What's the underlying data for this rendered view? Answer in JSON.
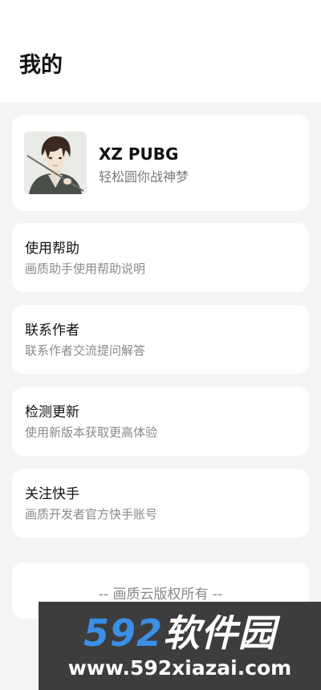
{
  "page": {
    "title": "我的"
  },
  "profile": {
    "avatar_icon": "avatar-illustration",
    "name": "XZ PUBG",
    "subtitle": "轻松圆你战神梦"
  },
  "menu": [
    {
      "title": "使用帮助",
      "subtitle": "画质助手使用帮助说明"
    },
    {
      "title": "联系作者",
      "subtitle": "联系作者交流提问解答"
    },
    {
      "title": "检测更新",
      "subtitle": "使用新版本获取更高体验"
    },
    {
      "title": "关注快手",
      "subtitle": "画质开发者官方快手账号"
    }
  ],
  "footer": {
    "copyright": "-- 画质云版权所有 --"
  },
  "watermark": {
    "digits": "592",
    "cn": "软件园",
    "url": "www.592xiazai.com",
    "colors": {
      "bg": "#3d3d3d",
      "digits": "#3a8fe6",
      "text": "#ffffff"
    }
  }
}
